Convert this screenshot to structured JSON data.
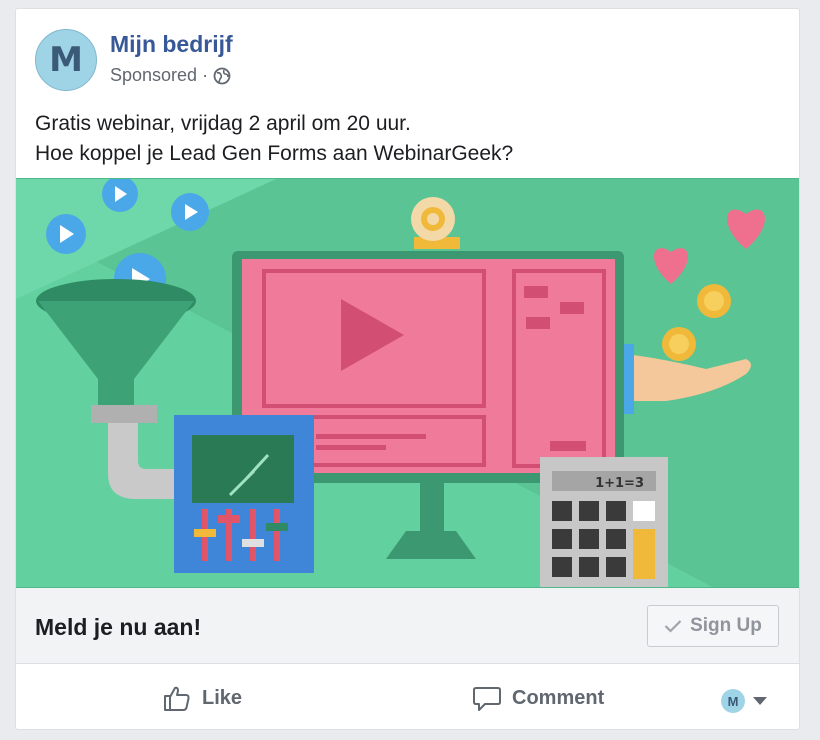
{
  "post": {
    "page_name": "Mijn bedrijf",
    "avatar_letter": "M",
    "sponsored_label": "Sponsored",
    "separator": "·",
    "text_line1": "Gratis webinar, vrijdag 2 april om 20 uur.",
    "text_line2": "Hoe koppel je Lead Gen Forms aan WebinarGeek?"
  },
  "media": {
    "calculator_display": "1+1=3"
  },
  "cta": {
    "headline": "Meld je nu aan!",
    "button_label": "Sign Up"
  },
  "actions": {
    "like_label": "Like",
    "comment_label": "Comment",
    "share_avatar_letter": "M"
  },
  "colors": {
    "link_blue": "#385898",
    "media_green": "#63d0a0",
    "screen_pink": "#f07a9a"
  }
}
